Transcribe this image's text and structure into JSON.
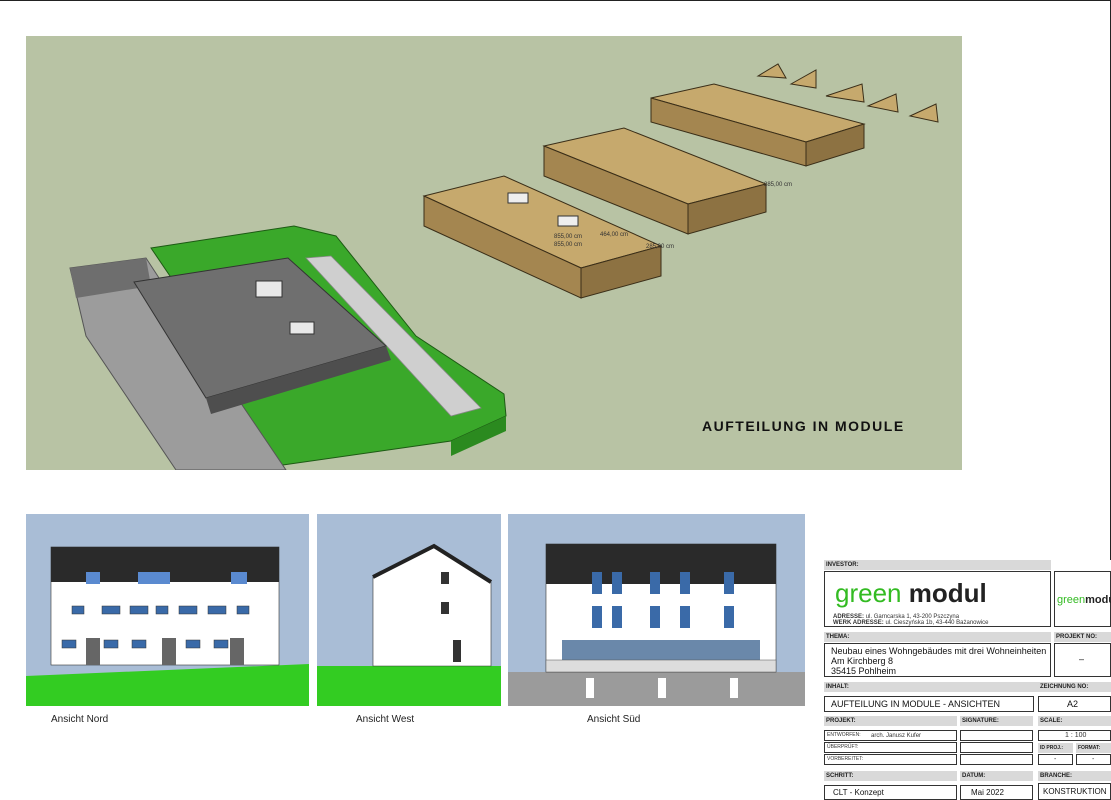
{
  "main_panel": {
    "title": "AUFTEILUNG IN MODULE",
    "dimension_labels": [
      "285,00 cm",
      "285,00 cm",
      "855,00 cm",
      "855,00 cm",
      "464,00 cm"
    ]
  },
  "elevations": [
    {
      "label": "Ansicht Nord"
    },
    {
      "label": "Ansicht West"
    },
    {
      "label": "Ansicht Süd"
    }
  ],
  "title_block": {
    "investor_label": "INVESTOR:",
    "brand_green": "green",
    "brand_dark": "modul",
    "address_label": "ADRESSE:",
    "address_value": "ul. Garncarska 1, 43-200 Pszczyna",
    "werk_label": "WERK ADRESSE:",
    "werk_value": "ul. Cieszyńska 1b, 43-440 Bażanowice",
    "logo_small_green": "green",
    "logo_small_dark": "modul",
    "thema_label": "THEMA:",
    "thema_line1": "Neubau eines Wohngebäudes mit drei Wohneinheiten",
    "thema_line2": "Am Kirchberg 8",
    "thema_line3": "35415 Pohlheim",
    "projekt_nr_label": "PROJEKT NO:",
    "projekt_nr_value": "–",
    "inhalt_label": "INHALT:",
    "inhalt_value": "AUFTEILUNG IN MODULE - ANSICHTEN",
    "zeichnung_label": "ZEICHNUNG NO:",
    "zeichnung_value": "A2",
    "projekt_label": "PROJEKT:",
    "signature_label": "SIGNATURE:",
    "scale_label": "SCALE:",
    "entworfen_label": "ENTWORFEN:",
    "entworfen_value": "arch. Janusz Kufer",
    "ueberprueft_label": "ÜBERPRÜFT:",
    "vorbereitet_label": "VORBEREITET:",
    "scale_value": "1 : 100",
    "id_proj_label": "ID PROJ.:",
    "format_label": "FORMAT:",
    "id_proj_value": "-",
    "format_value": "-",
    "schritt_label": "SCHRITT:",
    "schritt_value": "CLT - Konzept",
    "datum_label": "DATUM:",
    "datum_value": "Mai 2022",
    "branche_label": "BRANCHE:",
    "branche_value": "KONSTRUKTION"
  }
}
